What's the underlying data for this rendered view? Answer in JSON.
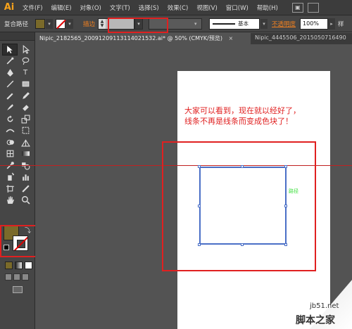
{
  "app": {
    "logo": "Ai"
  },
  "menubar": {
    "items": [
      "文件(F)",
      "编辑(E)",
      "对象(O)",
      "文字(T)",
      "选择(S)",
      "效果(C)",
      "视图(V)",
      "窗口(W)",
      "帮助(H)"
    ]
  },
  "controlbar": {
    "selection_label": "复合路径",
    "fill_color": "#7a6a2a",
    "stroke_label": "描边",
    "stroke_weight": "",
    "brush_label": "基本",
    "opacity_label": "不透明度",
    "opacity_value": "100%",
    "style_label": "样"
  },
  "tabs": [
    {
      "label": "Nipic_2182565_20091209113114021532.ai* @ 50% (CMYK/预览)",
      "close": "×",
      "active": true
    },
    {
      "label": "Nipic_4445506_2015050716490",
      "close": "",
      "active": false
    }
  ],
  "canvas": {
    "note_line1": "大家可以看到，现在就以经好了，",
    "note_line2": "线条不再是线条而变成色块了！",
    "path_label": "路径",
    "accent_red": "#e02020",
    "path_color": "#4a6fc7"
  },
  "watermark": {
    "site": "jb51.net",
    "name": "脚本之家"
  }
}
